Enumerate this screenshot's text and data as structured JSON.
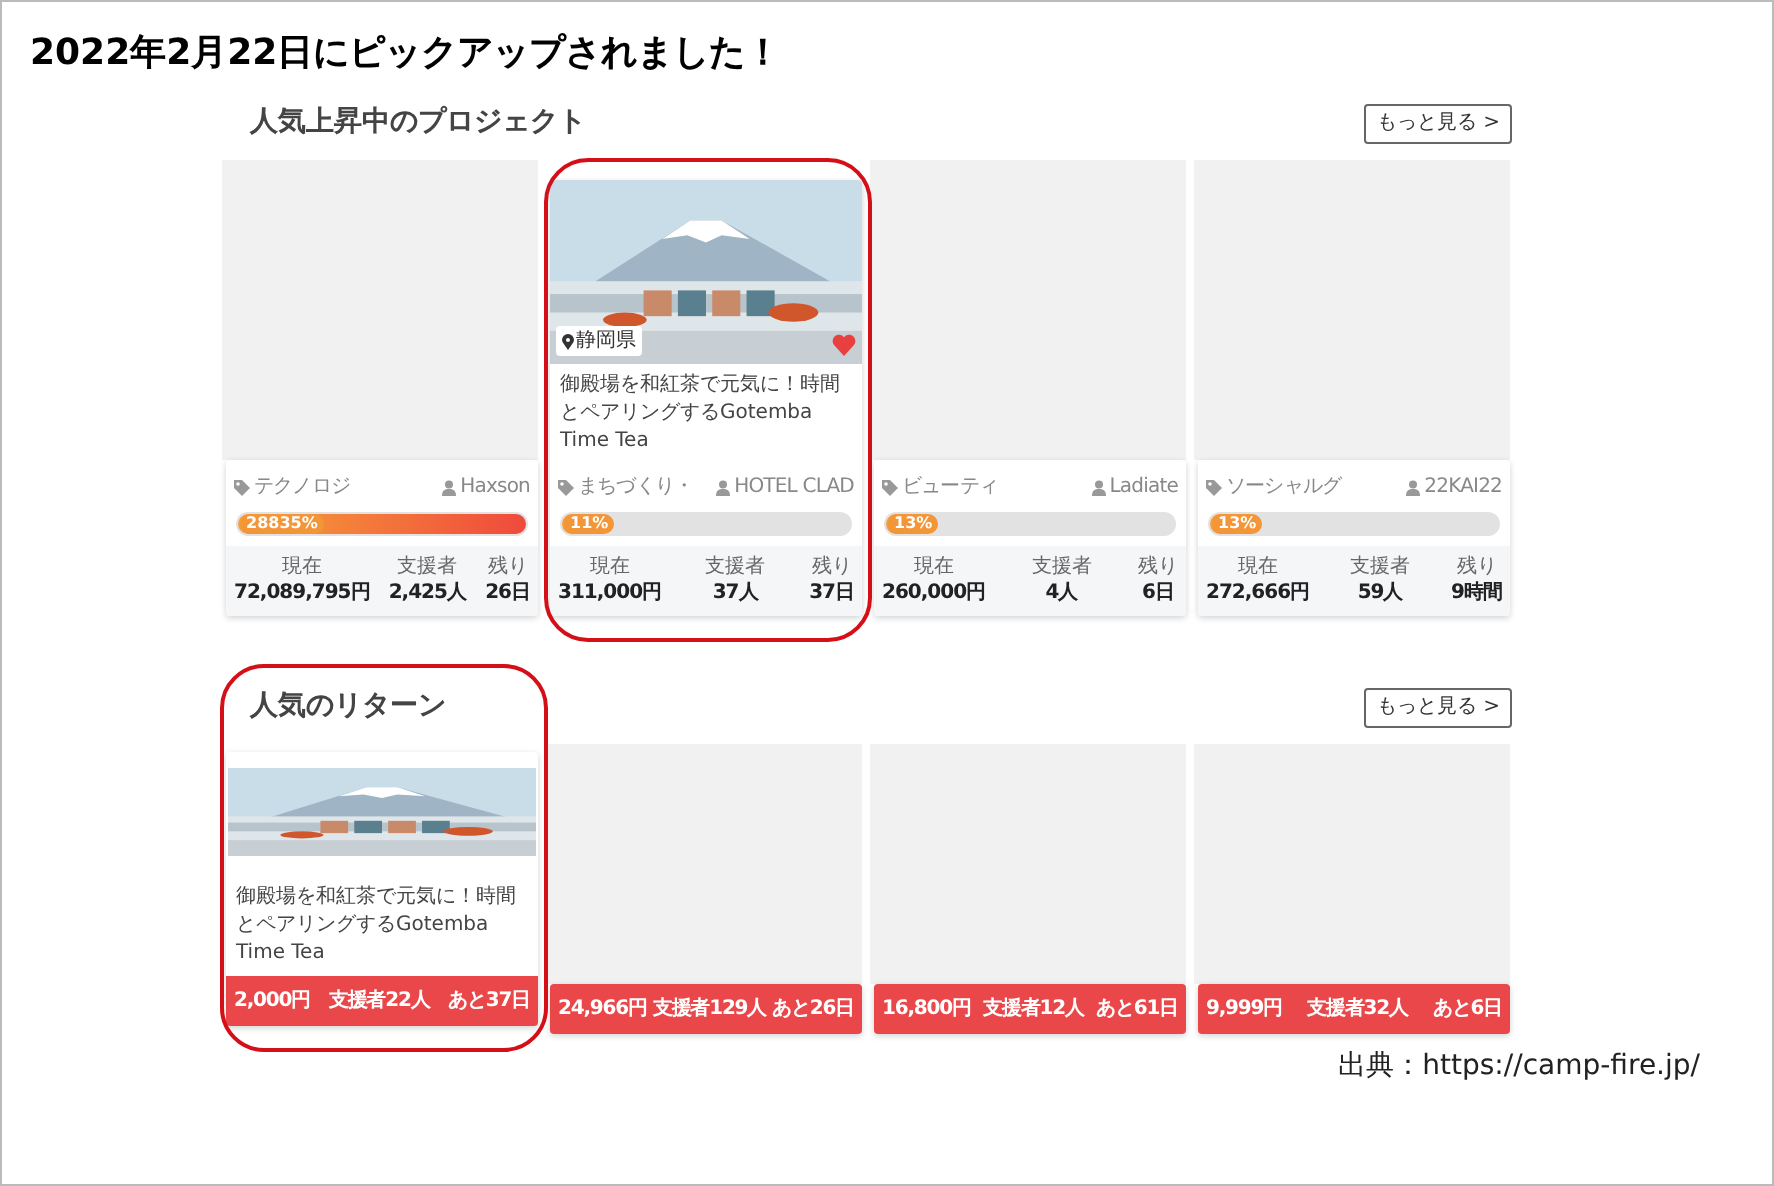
{
  "header": {
    "title": "2022年2月22日にピックアップされました！"
  },
  "sections": [
    {
      "heading": "人気上昇中のプロジェクト",
      "heading_circled": false,
      "more_button": "もっと見る >",
      "cards": [
        {
          "kind": "project",
          "covered": true,
          "circled": false,
          "category": "テクノロジ",
          "owner": "Haxson",
          "level": 1,
          "percent": "28835%",
          "stats": [
            {
              "label": "現在",
              "value": "72,089,795円"
            },
            {
              "label": "支援者",
              "value": "2,425人"
            },
            {
              "label": "残り",
              "value": "26日"
            }
          ]
        },
        {
          "kind": "project",
          "covered": false,
          "circled": true,
          "image": {
            "kind": "picture"
          },
          "location": "静岡県",
          "favorite": true,
          "title": "御殿場を和紅茶で元気に！時間とペアリングするGotemba Time Tea",
          "category": "まちづくり・",
          "owner": "HOTEL CLAD",
          "level": 0.11,
          "percent": "11%",
          "stats": [
            {
              "label": "現在",
              "value": "311,000円"
            },
            {
              "label": "支援者",
              "value": "37人"
            },
            {
              "label": "残り",
              "value": "37日"
            }
          ]
        },
        {
          "kind": "project",
          "covered": true,
          "circled": false,
          "category": "ビューティ",
          "owner": "Ladiate",
          "level": 0.13,
          "percent": "13%",
          "stats": [
            {
              "label": "現在",
              "value": "260,000円"
            },
            {
              "label": "支援者",
              "value": "4人"
            },
            {
              "label": "残り",
              "value": "6日"
            }
          ]
        },
        {
          "kind": "project",
          "covered": true,
          "circled": false,
          "category": "ソーシャルグ",
          "owner": "22KAI22",
          "level": 0.13,
          "percent": "13%",
          "stats": [
            {
              "label": "現在",
              "value": "272,666円"
            },
            {
              "label": "支援者",
              "value": "59人"
            },
            {
              "label": "残り",
              "value": "9時間"
            }
          ]
        }
      ]
    },
    {
      "heading": "人気のリターン",
      "heading_circled": true,
      "more_button": "もっと見る >",
      "cards": [
        {
          "kind": "return",
          "covered": false,
          "circled": true,
          "image": {
            "kind": "picture"
          },
          "title": "御殿場を和紅茶で元気に！時間とペアリングするGotemba Time Tea",
          "price": "2,000円",
          "backers": "支援者22人",
          "remaining": "あと37日"
        },
        {
          "kind": "return",
          "covered": true,
          "circled": false,
          "price": "24,966円",
          "backers": "支援者129人",
          "remaining": "あと26日"
        },
        {
          "kind": "return",
          "covered": true,
          "circled": false,
          "price": "16,800円",
          "backers": "支援者12人",
          "remaining": "あと61日"
        },
        {
          "kind": "return",
          "covered": true,
          "circled": false,
          "price": "9,999円",
          "backers": "支援者32人",
          "remaining": "あと6日"
        }
      ]
    }
  ],
  "source": "出典：https://camp-fire.jp/"
}
